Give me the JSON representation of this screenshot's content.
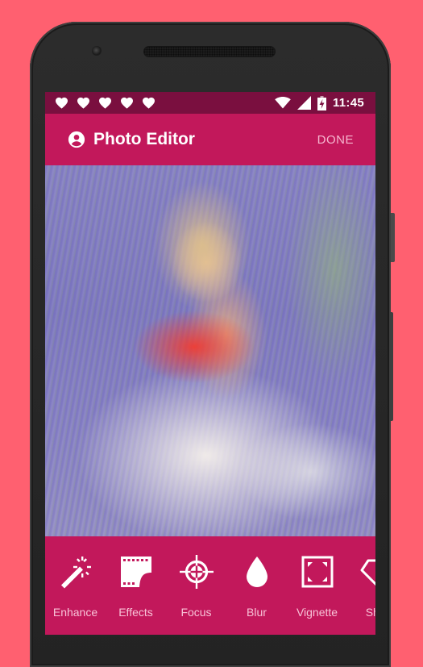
{
  "colors": {
    "background": "#ff6070",
    "status_bar": "#7a0f3f",
    "primary": "#c2185b",
    "done_text": "#f6b6cf",
    "tool_label": "#f8c2d7"
  },
  "status_bar": {
    "notification_icons": [
      "heart-icon",
      "heart-icon",
      "heart-icon",
      "heart-icon",
      "heart-icon"
    ],
    "system_icons": [
      "wifi-icon",
      "signal-icon",
      "battery-charging-icon"
    ],
    "time": "11:45"
  },
  "app_bar": {
    "icon": "account-circle-icon",
    "title": "Photo Editor",
    "action": "DONE"
  },
  "photo": {
    "description": "Woman in red top and white skirt in a lavender field"
  },
  "toolbar": {
    "tools": [
      {
        "icon": "magic-wand-icon",
        "label": "Enhance"
      },
      {
        "icon": "film-strip-icon",
        "label": "Effects"
      },
      {
        "icon": "crosshair-icon",
        "label": "Focus"
      },
      {
        "icon": "drop-icon",
        "label": "Blur"
      },
      {
        "icon": "vignette-frame-icon",
        "label": "Vignette"
      },
      {
        "icon": "diamond-icon",
        "label": "Shar"
      }
    ]
  }
}
